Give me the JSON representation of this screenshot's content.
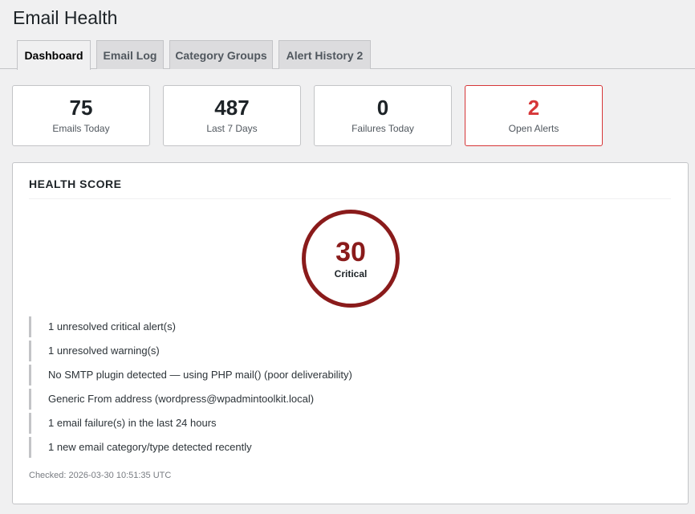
{
  "page": {
    "title": "Email Health"
  },
  "tabs": [
    {
      "label": "Dashboard",
      "active": true
    },
    {
      "label": "Email Log",
      "active": false
    },
    {
      "label": "Category Groups",
      "active": false
    },
    {
      "label": "Alert History 2",
      "active": false
    }
  ],
  "stats": [
    {
      "value": "75",
      "label": "Emails Today"
    },
    {
      "value": "487",
      "label": "Last 7 Days"
    },
    {
      "value": "0",
      "label": "Failures Today"
    },
    {
      "value": "2",
      "label": "Open Alerts"
    }
  ],
  "health": {
    "title": "HEALTH SCORE",
    "score": "30",
    "status": "Critical",
    "issues": [
      "1 unresolved critical alert(s)",
      "1 unresolved warning(s)",
      "No SMTP plugin detected — using PHP mail() (poor deliverability)",
      "Generic From address (wordpress@wpadmintoolkit.local)",
      "1 email failure(s) in the last 24 hours",
      "1 new email category/type detected recently"
    ],
    "checked": "Checked: 2026-03-30 10:51:35 UTC"
  },
  "colors": {
    "critical": "#8a1b1b",
    "alert": "#d63638",
    "background": "#f0f0f1"
  }
}
